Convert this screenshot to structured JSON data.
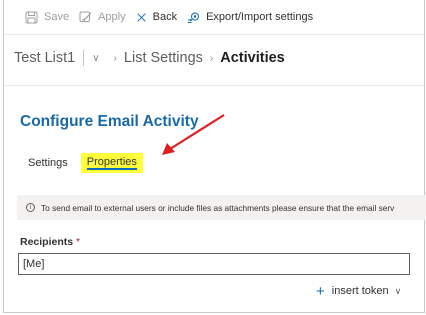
{
  "toolbar": {
    "save_label": "Save",
    "apply_label": "Apply",
    "back_label": "Back",
    "export_label": "Export/Import settings"
  },
  "breadcrumb": {
    "site": "Test List1",
    "list_settings": "List Settings",
    "current": "Activities"
  },
  "page": {
    "title": "Configure Email Activity"
  },
  "tabs": [
    {
      "label": "Settings"
    },
    {
      "label": "Properties"
    }
  ],
  "notice": {
    "text": "To send email to external users or include files as attachments please ensure that the email serv"
  },
  "recipients": {
    "label": "Recipients",
    "required_mark": "*",
    "value": "[Me]"
  },
  "insert_token": {
    "label": "insert token"
  },
  "colors": {
    "accent": "#0f6cbd",
    "title": "#1a6aa8",
    "highlight": "#ffff3a",
    "annotation_arrow": "#e02020"
  },
  "icons": [
    "save-icon",
    "apply-icon",
    "close-icon",
    "export-import-icon",
    "chevron-down-icon",
    "chevron-right-icon",
    "info-icon",
    "plus-icon",
    "red-arrow-annotation"
  ]
}
